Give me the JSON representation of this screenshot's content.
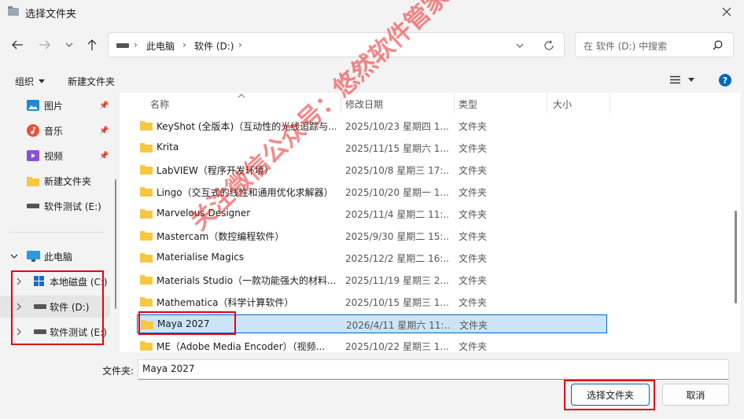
{
  "window": {
    "title": "选择文件夹"
  },
  "nav": {
    "breadcrumb": [
      "此电脑",
      "软件 (D:)"
    ],
    "search_placeholder": "在 软件 (D:) 中搜索"
  },
  "toolbar": {
    "organize": "组织",
    "new_folder": "新建文件夹"
  },
  "sidebar": {
    "items": [
      {
        "label": "图片",
        "pinned": true
      },
      {
        "label": "音乐",
        "pinned": true
      },
      {
        "label": "视频",
        "pinned": true
      },
      {
        "label": "新建文件夹",
        "pinned": false
      },
      {
        "label": "软件测试 (E:)",
        "pinned": false
      }
    ],
    "pc": "此电脑",
    "drives": [
      {
        "label": "本地磁盘 (C:)"
      },
      {
        "label": "软件 (D:)"
      },
      {
        "label": "软件测试 (E:)"
      }
    ]
  },
  "columns": {
    "name": "名称",
    "date": "修改日期",
    "type": "类型",
    "size": "大小"
  },
  "rows": [
    {
      "name": "KeyShot (全版本)（互动性的光线追踪与...",
      "date": "2025/10/23 星期四 1...",
      "type": "文件夹"
    },
    {
      "name": "Krita",
      "date": "2025/11/15 星期六 1...",
      "type": "文件夹"
    },
    {
      "name": "LabVIEW（程序开发环境）",
      "date": "2025/10/8 星期三 17:...",
      "type": "文件夹"
    },
    {
      "name": "Lingo（交互式的线性和通用优化求解器）",
      "date": "2025/10/20 星期一 1...",
      "type": "文件夹"
    },
    {
      "name": "Marvelous Designer",
      "date": "2025/11/4 星期二 11:...",
      "type": "文件夹"
    },
    {
      "name": "Mastercam（数控编程软件）",
      "date": "2025/9/30 星期二 15:...",
      "type": "文件夹"
    },
    {
      "name": "Materialise Magics",
      "date": "2025/12/2 星期二 16:...",
      "type": "文件夹"
    },
    {
      "name": "Materials Studio（一款功能强大的材料...",
      "date": "2025/11/19 星期三 2...",
      "type": "文件夹"
    },
    {
      "name": "Mathematica（科学计算软件）",
      "date": "2025/10/15 星期三 1...",
      "type": "文件夹"
    },
    {
      "name": "Maya 2027",
      "date": "2026/4/11 星期六 11:...",
      "type": "文件夹"
    },
    {
      "name": "ME（Adobe Media Encoder）（视频...",
      "date": "2025/10/22 星期三 1...",
      "type": "文件夹"
    }
  ],
  "footer": {
    "folder_label": "文件夹:",
    "folder_value": "Maya 2027",
    "select_button": "选择文件夹",
    "cancel_button": "取消"
  },
  "watermark": "关注微信公众号：悠然软件管家",
  "colors": {
    "accent": "#0067c0",
    "selection": "#cce4f7",
    "folder": "#f8c742",
    "annotation_red": "#e60012"
  }
}
